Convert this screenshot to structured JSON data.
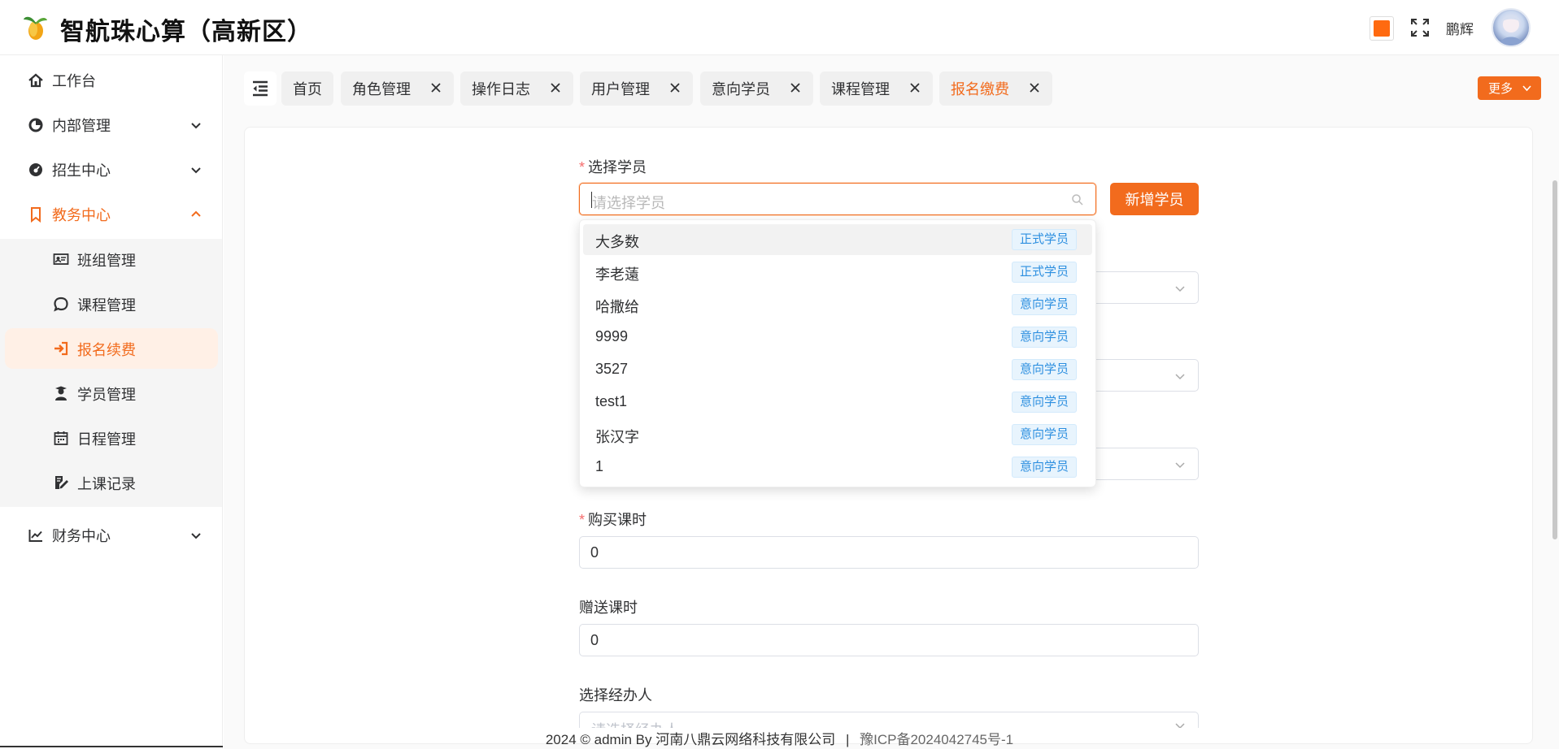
{
  "header": {
    "app_title": "智航珠心算（高新区）",
    "username": "鹏辉",
    "theme_color": "#ff6a10"
  },
  "sidebar": {
    "items": [
      {
        "label": "工作台",
        "icon": "home-icon"
      },
      {
        "label": "内部管理",
        "icon": "chart-circle-icon"
      },
      {
        "label": "招生中心",
        "icon": "dashboard-icon"
      },
      {
        "label": "教务中心",
        "icon": "bookmark-icon"
      },
      {
        "label": "财务中心",
        "icon": "trend-chart-icon"
      }
    ],
    "sub_items": [
      {
        "label": "班组管理",
        "icon": "id-card-icon"
      },
      {
        "label": "课程管理",
        "icon": "chat-icon"
      },
      {
        "label": "报名续费",
        "icon": "sign-in-icon"
      },
      {
        "label": "学员管理",
        "icon": "student-icon"
      },
      {
        "label": "日程管理",
        "icon": "calendar-icon"
      },
      {
        "label": "上课记录",
        "icon": "edit-record-icon"
      }
    ]
  },
  "tabs": [
    {
      "label": "首页"
    },
    {
      "label": "角色管理"
    },
    {
      "label": "操作日志"
    },
    {
      "label": "用户管理"
    },
    {
      "label": "意向学员"
    },
    {
      "label": "课程管理"
    },
    {
      "label": "报名缴费"
    }
  ],
  "more_button": "更多",
  "form": {
    "student_label": "选择学员",
    "student_placeholder": "请选择学员",
    "add_student_button": "新增学员",
    "buy_hours_label": "购买课时",
    "buy_hours_value": "0",
    "gift_hours_label": "赠送课时",
    "gift_hours_value": "0",
    "agent_label": "选择经办人",
    "agent_placeholder": "请选择经办人"
  },
  "dropdown": [
    {
      "name": "大多数",
      "tag": "正式学员"
    },
    {
      "name": "李老薳",
      "tag": "正式学员"
    },
    {
      "name": "哈撒给",
      "tag": "意向学员"
    },
    {
      "name": "9999",
      "tag": "意向学员"
    },
    {
      "name": "3527",
      "tag": "意向学员"
    },
    {
      "name": "test1",
      "tag": "意向学员"
    },
    {
      "name": "张汉字",
      "tag": "意向学员"
    },
    {
      "name": "1",
      "tag": "意向学员"
    }
  ],
  "footer": {
    "copyright": "2024 © admin By 河南八鼎云网络科技有限公司",
    "separator": "|",
    "icp": "豫ICP备2024042745号-1"
  }
}
